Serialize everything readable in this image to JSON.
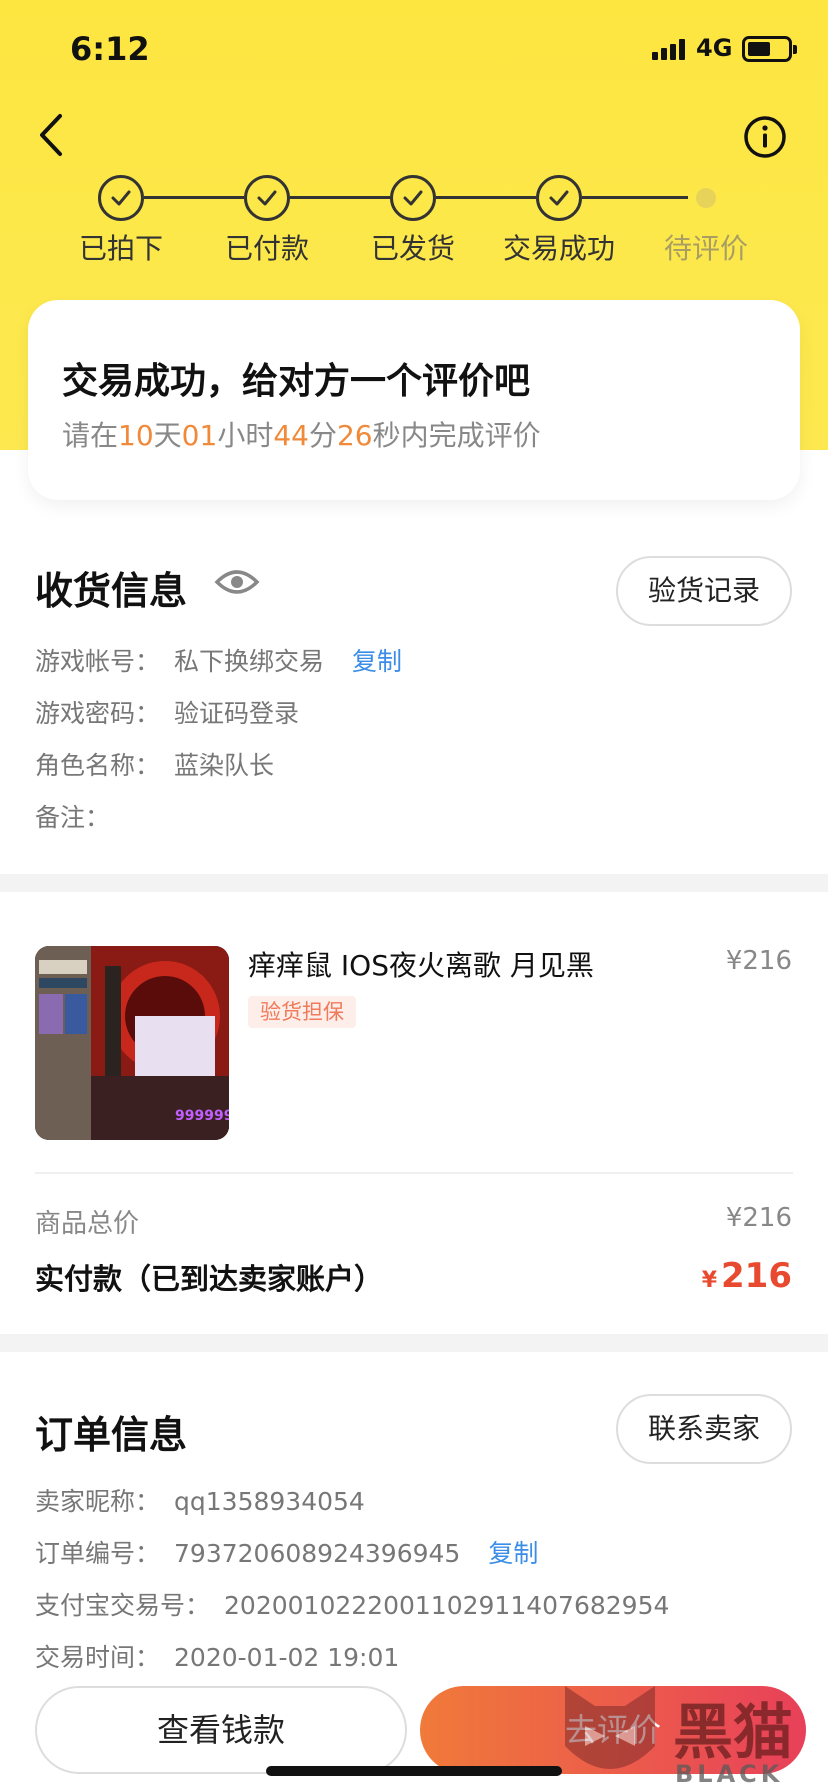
{
  "status_bar": {
    "time": "6:12",
    "network": "4G"
  },
  "progress": {
    "steps": [
      {
        "label": "已拍下",
        "done": true
      },
      {
        "label": "已付款",
        "done": true
      },
      {
        "label": "已发货",
        "done": true
      },
      {
        "label": "交易成功",
        "done": true
      },
      {
        "label": "待评价",
        "done": false
      }
    ]
  },
  "hero": {
    "title": "交易成功，给对方一个评价吧",
    "countdown": {
      "prefix": "请在",
      "days": "10",
      "days_unit": "天",
      "hours": "01",
      "hours_unit": "小时",
      "minutes": "44",
      "minutes_unit": "分",
      "seconds": "26",
      "seconds_unit": "秒内完成评价"
    }
  },
  "delivery": {
    "title": "收货信息",
    "inspect_button": "验货记录",
    "rows": [
      {
        "label": "游戏帐号：",
        "value": "私下换绑交易",
        "copy": "复制"
      },
      {
        "label": "游戏密码：",
        "value": "验证码登录"
      },
      {
        "label": "角色名称：",
        "value": "蓝染队长"
      },
      {
        "label": "备注：",
        "value": ""
      }
    ]
  },
  "product": {
    "name": "痒痒鼠 IOS夜火离歌 月见黑",
    "price": "¥216",
    "tag": "验货担保",
    "thumb_overlay_text": "999999",
    "total_label": "商品总价",
    "total_value": "¥216",
    "paid_label": "实付款（已到达卖家账户）",
    "paid_currency": "¥",
    "paid_value": "216"
  },
  "order": {
    "title": "订单信息",
    "contact_button": "联系卖家",
    "rows": [
      {
        "label": "卖家昵称：",
        "value": "qq1358934054"
      },
      {
        "label": "订单编号：",
        "value": "793720608924396945",
        "copy": "复制"
      },
      {
        "label": "支付宝交易号：",
        "value": "2020010222001102911407682954"
      },
      {
        "label": "交易时间：",
        "value": "2020-01-02 19:01"
      }
    ]
  },
  "actions": {
    "view_money": "查看钱款",
    "review": "去评价"
  },
  "watermark": {
    "text": "黑猫",
    "sub": "BLACK CAT"
  },
  "colors": {
    "accent_yellow": "#fde640",
    "accent_orange": "#f08a3a",
    "price_red": "#e84a30",
    "link_blue": "#3b8ee8"
  }
}
